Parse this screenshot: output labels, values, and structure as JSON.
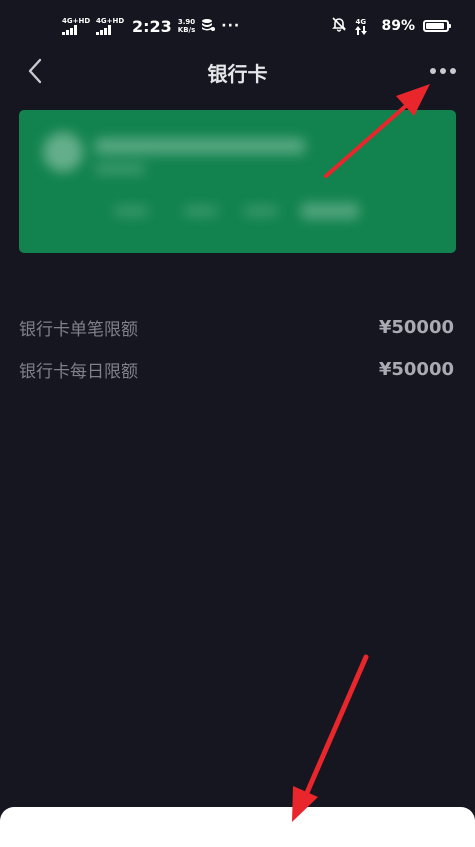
{
  "status_bar": {
    "network1": "4G+HD",
    "network2": "4G+HD",
    "time": "2:23",
    "speed_value": "3.90",
    "speed_unit": "KB/s",
    "more": "···",
    "right_network": "4G",
    "battery_percent": "89%",
    "battery_level": 0.89
  },
  "header": {
    "title": "银行卡"
  },
  "card": {
    "color": "#12834e"
  },
  "limits": [
    {
      "label": "银行卡单笔限额",
      "value": "¥50000"
    },
    {
      "label": "银行卡每日限额",
      "value": "¥50000"
    }
  ],
  "icons": {
    "back": "chevron-left-icon",
    "more": "more-horizontal-icon"
  },
  "colors": {
    "background": "#15161f",
    "annotation_arrow": "#e8262b"
  }
}
